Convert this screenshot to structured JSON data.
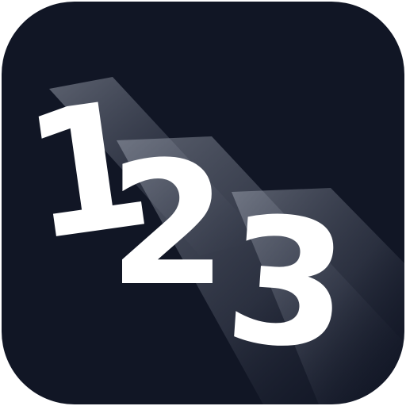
{
  "icon": {
    "digits": [
      "1",
      "2",
      "3"
    ],
    "background_color": "#111625",
    "digit_color": "#ffffff",
    "shadow_color": "#8a8f9c"
  }
}
